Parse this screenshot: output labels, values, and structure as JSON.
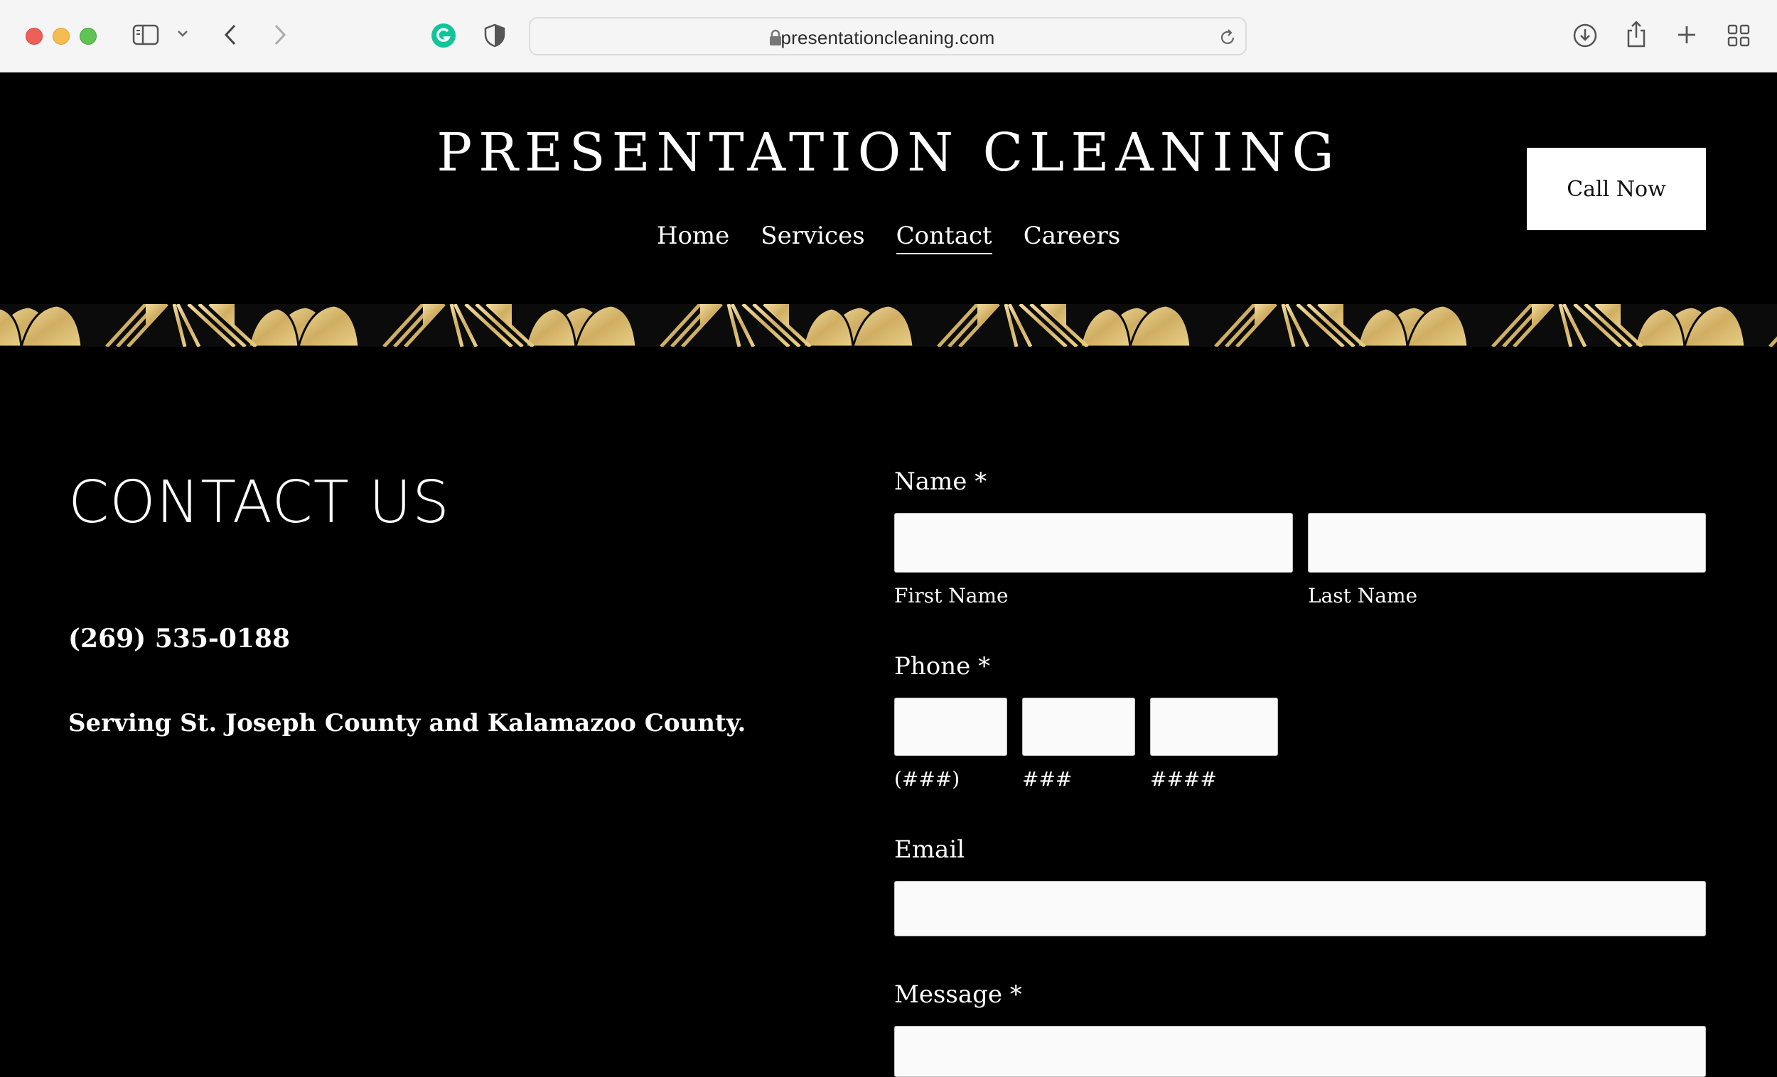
{
  "browser": {
    "url": "presentationcleaning.com"
  },
  "header": {
    "logo": "PRESENTATION CLEANING",
    "nav": [
      {
        "label": "Home",
        "active": false
      },
      {
        "label": "Services",
        "active": false
      },
      {
        "label": "Contact",
        "active": true
      },
      {
        "label": "Careers",
        "active": false
      }
    ],
    "cta_label": "Call Now"
  },
  "colors": {
    "background": "#000000",
    "gold": "#d8bd74",
    "button_bg": "#ffffff",
    "field_bg": "#fafafa"
  },
  "contact": {
    "title": "CONTACT US",
    "phone": "(269) 535-0188",
    "service_area": "Serving St. Joseph County and Kalamazoo County."
  },
  "form": {
    "name_label": "Name *",
    "first_name_label": "First Name",
    "last_name_label": "Last Name",
    "first_name_value": "",
    "last_name_value": "",
    "phone_label": "Phone *",
    "phone_area_label": "(###)",
    "phone_prefix_label": "###",
    "phone_line_label": "####",
    "email_label": "Email",
    "email_value": "",
    "message_label": "Message *",
    "message_value": ""
  }
}
